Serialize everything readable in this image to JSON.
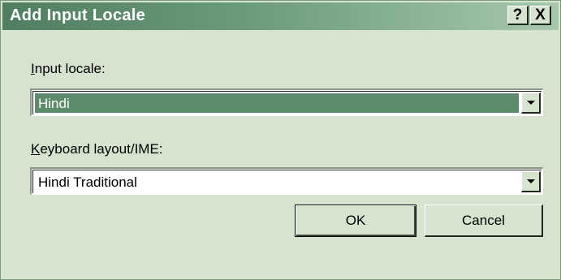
{
  "window": {
    "title": "Add Input Locale",
    "help_label": "?",
    "close_label": "X"
  },
  "input_locale": {
    "label_mnemonic": "I",
    "label_rest": "nput locale:",
    "value": "Hindi"
  },
  "keyboard_layout": {
    "label_mnemonic": "K",
    "label_rest": "eyboard layout/IME:",
    "value": "Hindi Traditional"
  },
  "buttons": {
    "ok": "OK",
    "cancel": "Cancel"
  },
  "colors": {
    "dialog_bg": "#d6e3cf",
    "titlebar_start": "#4f7e60",
    "titlebar_end": "#a8c8ad",
    "selection": "#5d8c6c"
  },
  "icons": {
    "dropdown": "chevron-down-icon",
    "close": "close-icon",
    "help": "help-icon"
  }
}
